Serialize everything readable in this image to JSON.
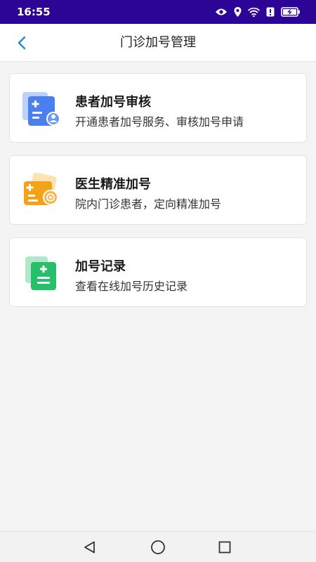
{
  "status_bar": {
    "time": "16:55"
  },
  "header": {
    "title": "门诊加号管理"
  },
  "cards": [
    {
      "title": "患者加号审核",
      "description": "开通患者加号服务、审核加号申请",
      "icon": "patient-review-icon",
      "color": "#4a7ff0"
    },
    {
      "title": "医生精准加号",
      "description": "院内门诊患者，定向精准加号",
      "icon": "doctor-add-icon",
      "color": "#f5a21b"
    },
    {
      "title": "加号记录",
      "description": "查看在线加号历史记录",
      "icon": "record-list-icon",
      "color": "#27c06a"
    }
  ],
  "colors": {
    "status_bar": "#2c0596",
    "back_arrow": "#2a86d6"
  }
}
